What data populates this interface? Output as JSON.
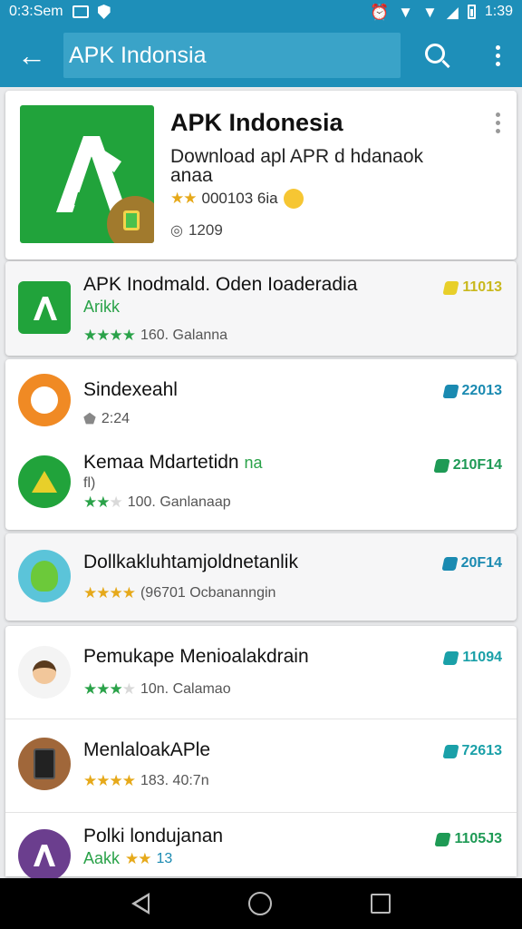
{
  "status_bar": {
    "time_left": "0:3:Sem",
    "time_right": "1:39",
    "icons": [
      "notification-box-icon",
      "shield-icon",
      "alarm-icon",
      "wifi-icon",
      "wifi-icon",
      "signal-icon",
      "battery-icon"
    ]
  },
  "app_bar": {
    "search_value": "APK Indonsia",
    "back_icon": "arrow-left-icon",
    "search_icon": "search-icon",
    "menu_icon": "more-vert-icon"
  },
  "featured": {
    "title": "APK Indonesia",
    "description": "Download apl APR d hdanaok anaa",
    "stars": "★★",
    "rating_text": "000103 6ia",
    "installs": "1209",
    "icon_color": "#21a33b"
  },
  "apps": [
    {
      "title": "APK Inodmald. Oden Ioaderadia",
      "subtitle": "Arikk",
      "stars_on": "★★★★",
      "stars_off": "",
      "meta": "160. Galanna",
      "price": "11013",
      "price_color": "#c9b81e",
      "icon_color": "#21a33b"
    },
    {
      "title": "Sindexeahl",
      "subtitle": "",
      "stars_on": "",
      "stars_off": "",
      "meta": "2:24",
      "price": "22013",
      "price_color": "#1a8ab1",
      "icon_color": "#f08a24"
    },
    {
      "title": "Kemaa Mdartetidn",
      "title_extra": "na",
      "subtitle": "fl)",
      "stars_on": "★★",
      "stars_off": "★",
      "meta": "100. Ganlanaap",
      "price": "210F14",
      "price_color": "#1e9a55",
      "icon_color": "#21a33b"
    },
    {
      "title": "Dollkakluhtamjoldnetanlik",
      "subtitle": "",
      "stars_on": "★★★★",
      "stars_off": "",
      "meta": "(96701 Ocbananngin",
      "price": "20F14",
      "price_color": "#1a8ab1",
      "icon_color": "#5bc4d9"
    },
    {
      "title": "Pemukape Menioalakdrain",
      "subtitle": "",
      "stars_on": "★★★",
      "stars_off": "★",
      "meta": "10n. Calamao",
      "price": "11094",
      "price_color": "#1aa0a8",
      "icon_color": "#f4f4f4"
    },
    {
      "title": "MenlaloakAPle",
      "subtitle": "",
      "stars_on": "★★★★",
      "stars_off": "",
      "meta": "183. 40:7n",
      "price": "72613",
      "price_color": "#1aa0a8",
      "icon_color": "#a0673a"
    },
    {
      "title": "Polki londujanan",
      "subtitle": "Aakk",
      "stars_on": "★★",
      "stars_off": "",
      "meta": "13",
      "price": "1105J3",
      "price_color": "#1e9a55",
      "icon_color": "#6b3e8e"
    }
  ]
}
